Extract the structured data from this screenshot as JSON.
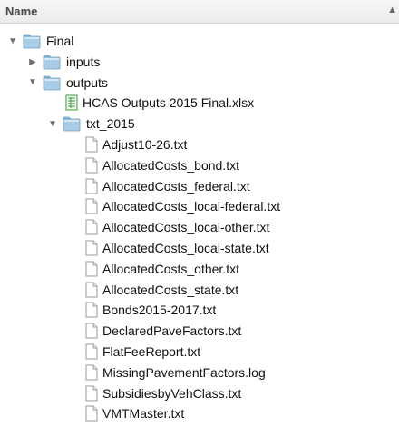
{
  "header": {
    "name_label": "Name",
    "sort_glyph": "▲"
  },
  "tree": [
    {
      "label": "Final",
      "kind": "folder",
      "depth": 0,
      "expanded": true,
      "icon": "folder-icon"
    },
    {
      "label": "inputs",
      "kind": "folder",
      "depth": 1,
      "expanded": false,
      "icon": "folder-icon"
    },
    {
      "label": "outputs",
      "kind": "folder",
      "depth": 1,
      "expanded": true,
      "icon": "folder-icon"
    },
    {
      "label": "HCAS Outputs 2015 Final.xlsx",
      "kind": "spreadsheet",
      "depth": 2,
      "icon": "spreadsheet-icon"
    },
    {
      "label": "txt_2015",
      "kind": "folder",
      "depth": 2,
      "expanded": true,
      "icon": "folder-icon"
    },
    {
      "label": "Adjust10-26.txt",
      "kind": "file",
      "depth": 3,
      "icon": "document-icon"
    },
    {
      "label": "AllocatedCosts_bond.txt",
      "kind": "file",
      "depth": 3,
      "icon": "document-icon"
    },
    {
      "label": "AllocatedCosts_federal.txt",
      "kind": "file",
      "depth": 3,
      "icon": "document-icon"
    },
    {
      "label": "AllocatedCosts_local-federal.txt",
      "kind": "file",
      "depth": 3,
      "icon": "document-icon"
    },
    {
      "label": "AllocatedCosts_local-other.txt",
      "kind": "file",
      "depth": 3,
      "icon": "document-icon"
    },
    {
      "label": "AllocatedCosts_local-state.txt",
      "kind": "file",
      "depth": 3,
      "icon": "document-icon"
    },
    {
      "label": "AllocatedCosts_other.txt",
      "kind": "file",
      "depth": 3,
      "icon": "document-icon"
    },
    {
      "label": "AllocatedCosts_state.txt",
      "kind": "file",
      "depth": 3,
      "icon": "document-icon"
    },
    {
      "label": "Bonds2015-2017.txt",
      "kind": "file",
      "depth": 3,
      "icon": "document-icon"
    },
    {
      "label": "DeclaredPaveFactors.txt",
      "kind": "file",
      "depth": 3,
      "icon": "document-icon"
    },
    {
      "label": "FlatFeeReport.txt",
      "kind": "file",
      "depth": 3,
      "icon": "document-icon"
    },
    {
      "label": "MissingPavementFactors.log",
      "kind": "file",
      "depth": 3,
      "icon": "document-icon"
    },
    {
      "label": "SubsidiesbyVehClass.txt",
      "kind": "file",
      "depth": 3,
      "icon": "document-icon"
    },
    {
      "label": "VMTMaster.txt",
      "kind": "file",
      "depth": 3,
      "icon": "document-icon"
    }
  ],
  "colors": {
    "folder_body": "#a9cde6",
    "folder_tab": "#8fbcdc",
    "folder_edge": "#6f9fc2",
    "disclosure": "#6f6f6f",
    "spreadsheet_green": "#3a9a3a"
  }
}
